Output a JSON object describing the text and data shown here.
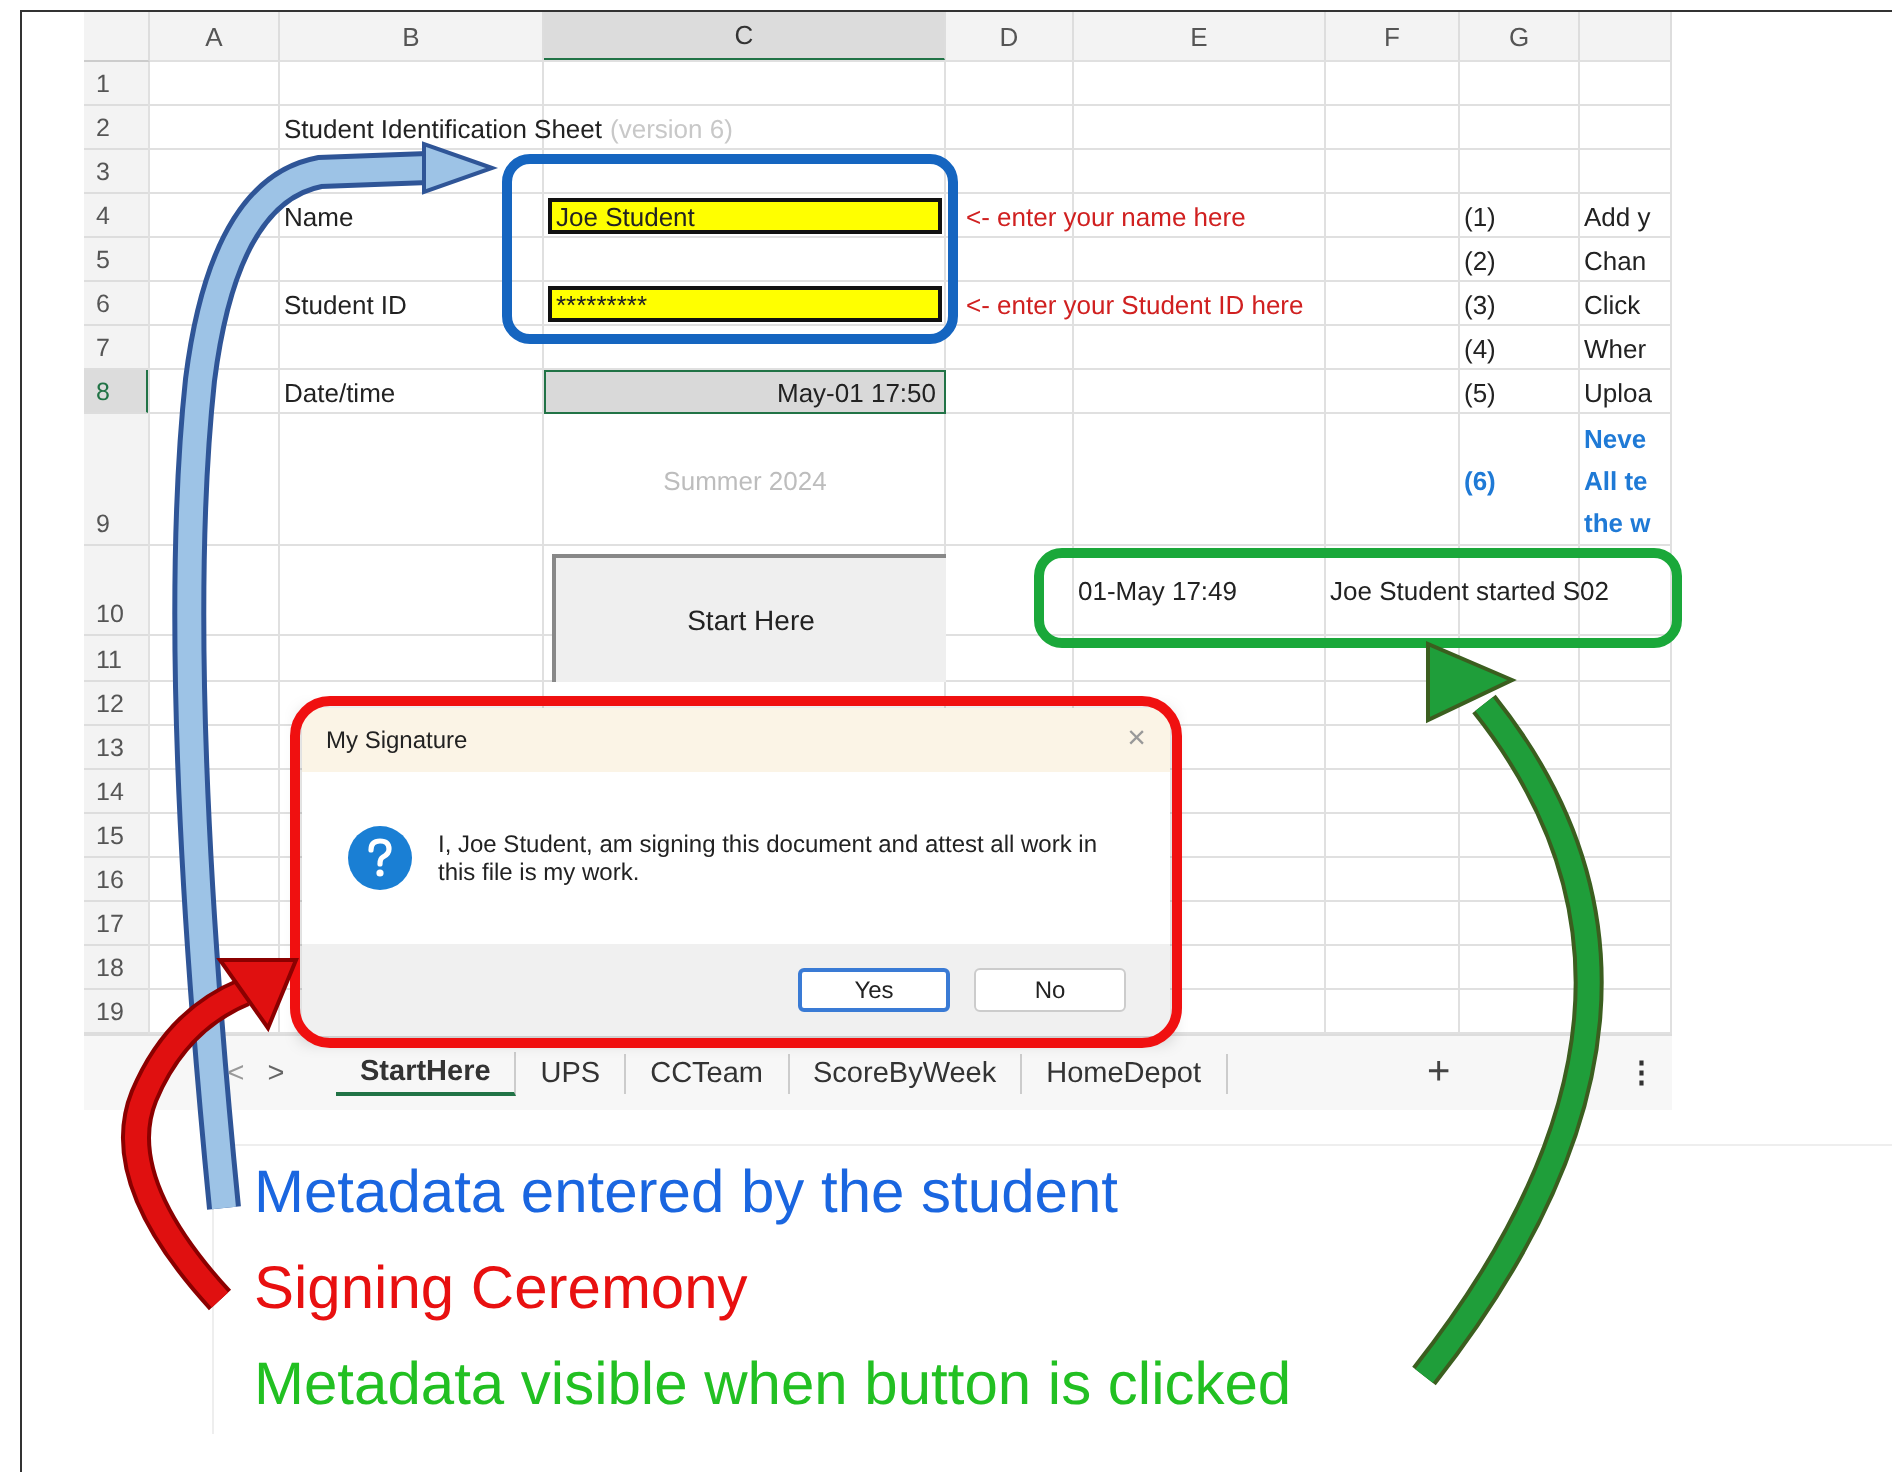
{
  "sheet": {
    "columns": [
      {
        "label": "A",
        "selected": false
      },
      {
        "label": "B",
        "selected": false
      },
      {
        "label": "C",
        "selected": true
      },
      {
        "label": "D",
        "selected": false
      },
      {
        "label": "E",
        "selected": false
      },
      {
        "label": "F",
        "selected": false
      },
      {
        "label": "G",
        "selected": false
      },
      {
        "selected": false
      }
    ],
    "rows": [
      {
        "number": "1",
        "selected": false
      },
      {
        "number": "2",
        "selected": false,
        "cells": [
          null,
          {
            "kind": "title",
            "text": "Student Identification Sheet",
            "note": "(version 6)"
          }
        ]
      },
      {
        "number": "3",
        "selected": false
      },
      {
        "number": "4",
        "selected": false,
        "cells": [
          null,
          {
            "kind": "label",
            "text": "Name"
          },
          {
            "kind": "input",
            "text": "Joe Student"
          },
          {
            "kind": "hint",
            "text": "<- enter your name here"
          },
          null,
          null,
          {
            "kind": "step",
            "text": "(1)"
          },
          {
            "kind": "step",
            "text": "Add y"
          }
        ]
      },
      {
        "number": "5",
        "selected": false,
        "cells": [
          null,
          null,
          null,
          null,
          null,
          null,
          {
            "kind": "step",
            "text": "(2)"
          },
          {
            "kind": "step",
            "text": "Chan"
          }
        ]
      },
      {
        "number": "6",
        "selected": false,
        "cells": [
          null,
          {
            "kind": "label",
            "text": "Student ID"
          },
          {
            "kind": "input",
            "text": "*********"
          },
          {
            "kind": "hint",
            "text": "<- enter your Student ID here"
          },
          null,
          null,
          {
            "kind": "step",
            "text": "(3)"
          },
          {
            "kind": "step",
            "text": "Click"
          }
        ]
      },
      {
        "number": "7",
        "selected": false,
        "cells": [
          null,
          null,
          null,
          null,
          null,
          null,
          {
            "kind": "step",
            "text": "(4)"
          },
          {
            "kind": "step",
            "text": "Wher"
          }
        ]
      },
      {
        "number": "8",
        "selected": true,
        "cells": [
          null,
          {
            "kind": "label",
            "text": "Date/time"
          },
          {
            "kind": "date",
            "text": "May-01 17:50"
          },
          null,
          null,
          null,
          {
            "kind": "step",
            "text": "(5)"
          },
          {
            "kind": "step",
            "text": "Uploa"
          }
        ]
      },
      {
        "number": "9",
        "selected": false,
        "cells": [
          null,
          null,
          {
            "kind": "faint",
            "text": "Summer 2024"
          },
          null,
          null,
          null,
          {
            "kind": "warning",
            "text": "(6)"
          },
          {
            "kind": "warning-lines",
            "lines": [
              "Neve",
              "All te",
              "the w"
            ]
          }
        ]
      },
      {
        "number": "10",
        "selected": false,
        "cells": [
          null,
          null,
          {
            "kind": "button",
            "text": "Start Here"
          },
          null,
          {
            "kind": "label",
            "text": "01-May 17:49"
          },
          {
            "kind": "label",
            "text": "Joe Student started S02"
          }
        ]
      },
      {
        "number": "11",
        "selected": false
      },
      {
        "number": "12",
        "selected": false
      },
      {
        "number": "13",
        "selected": false
      },
      {
        "number": "14",
        "selected": false
      },
      {
        "number": "15",
        "selected": false
      },
      {
        "number": "16",
        "selected": false
      },
      {
        "number": "17",
        "selected": false
      },
      {
        "number": "18",
        "selected": false
      },
      {
        "number": "19",
        "selected": false
      }
    ],
    "nav": [
      "<",
      ">"
    ],
    "tabs": [
      {
        "label": "StartHere",
        "selected": true
      },
      {
        "label": "UPS",
        "selected": false
      },
      {
        "label": "CCTeam",
        "selected": false
      },
      {
        "label": "ScoreByWeek",
        "selected": false
      },
      {
        "label": "HomeDepot",
        "selected": false
      }
    ],
    "add_tab": "+",
    "more": "⋮"
  },
  "dialog": {
    "title": "My Signature",
    "close": "×",
    "message": "I, Joe Student, am signing this document and attest all work in this file is my work.",
    "buttons": [
      {
        "label": "Yes",
        "selected": true
      },
      {
        "label": "No",
        "selected": false
      }
    ]
  },
  "legend": [
    {
      "text": "Metadata entered by the student",
      "color": "#1a66e0"
    },
    {
      "text": "Signing Ceremony",
      "color": "#e81010"
    },
    {
      "text": "Metadata visible when button is clicked",
      "color": "#22c022"
    }
  ]
}
